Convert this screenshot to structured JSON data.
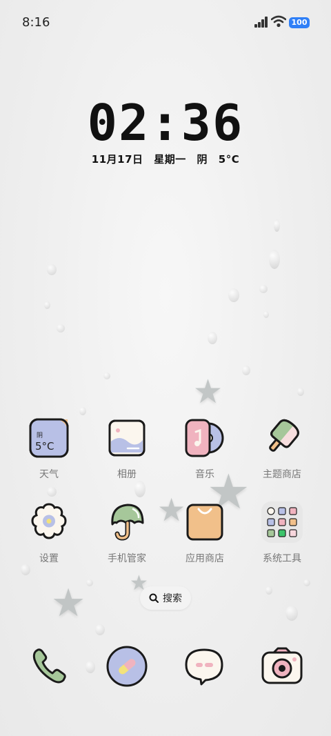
{
  "status": {
    "time": "8:16",
    "battery": "100"
  },
  "clock": {
    "time": "02:36"
  },
  "date": {
    "day": "11月17日",
    "weekday": "星期一",
    "weather": "阴",
    "temp": "5°C"
  },
  "weather_tile": {
    "condition": "阴",
    "temp": "5°C"
  },
  "apps_row1": [
    {
      "label": "天气",
      "icon": "weather-icon"
    },
    {
      "label": "相册",
      "icon": "gallery-icon"
    },
    {
      "label": "音乐",
      "icon": "music-icon"
    },
    {
      "label": "主题商店",
      "icon": "theme-store-icon"
    }
  ],
  "apps_row2": [
    {
      "label": "设置",
      "icon": "settings-icon"
    },
    {
      "label": "手机管家",
      "icon": "phone-manager-icon"
    },
    {
      "label": "应用商店",
      "icon": "app-store-icon"
    },
    {
      "label": "系统工具",
      "icon": "system-tools-folder-icon"
    }
  ],
  "search": {
    "label": "搜索"
  },
  "dock": [
    {
      "icon": "phone-icon"
    },
    {
      "icon": "browser-icon"
    },
    {
      "icon": "messages-icon"
    },
    {
      "icon": "camera-icon"
    }
  ],
  "colors": {
    "battery": "#2f7ff7",
    "outline": "#1a1a1a",
    "sage": "#a6c79a",
    "lavender": "#b8c0e6",
    "pink": "#f0b3bf",
    "peach": "#f1c08a",
    "cream": "#fbf6ee"
  }
}
